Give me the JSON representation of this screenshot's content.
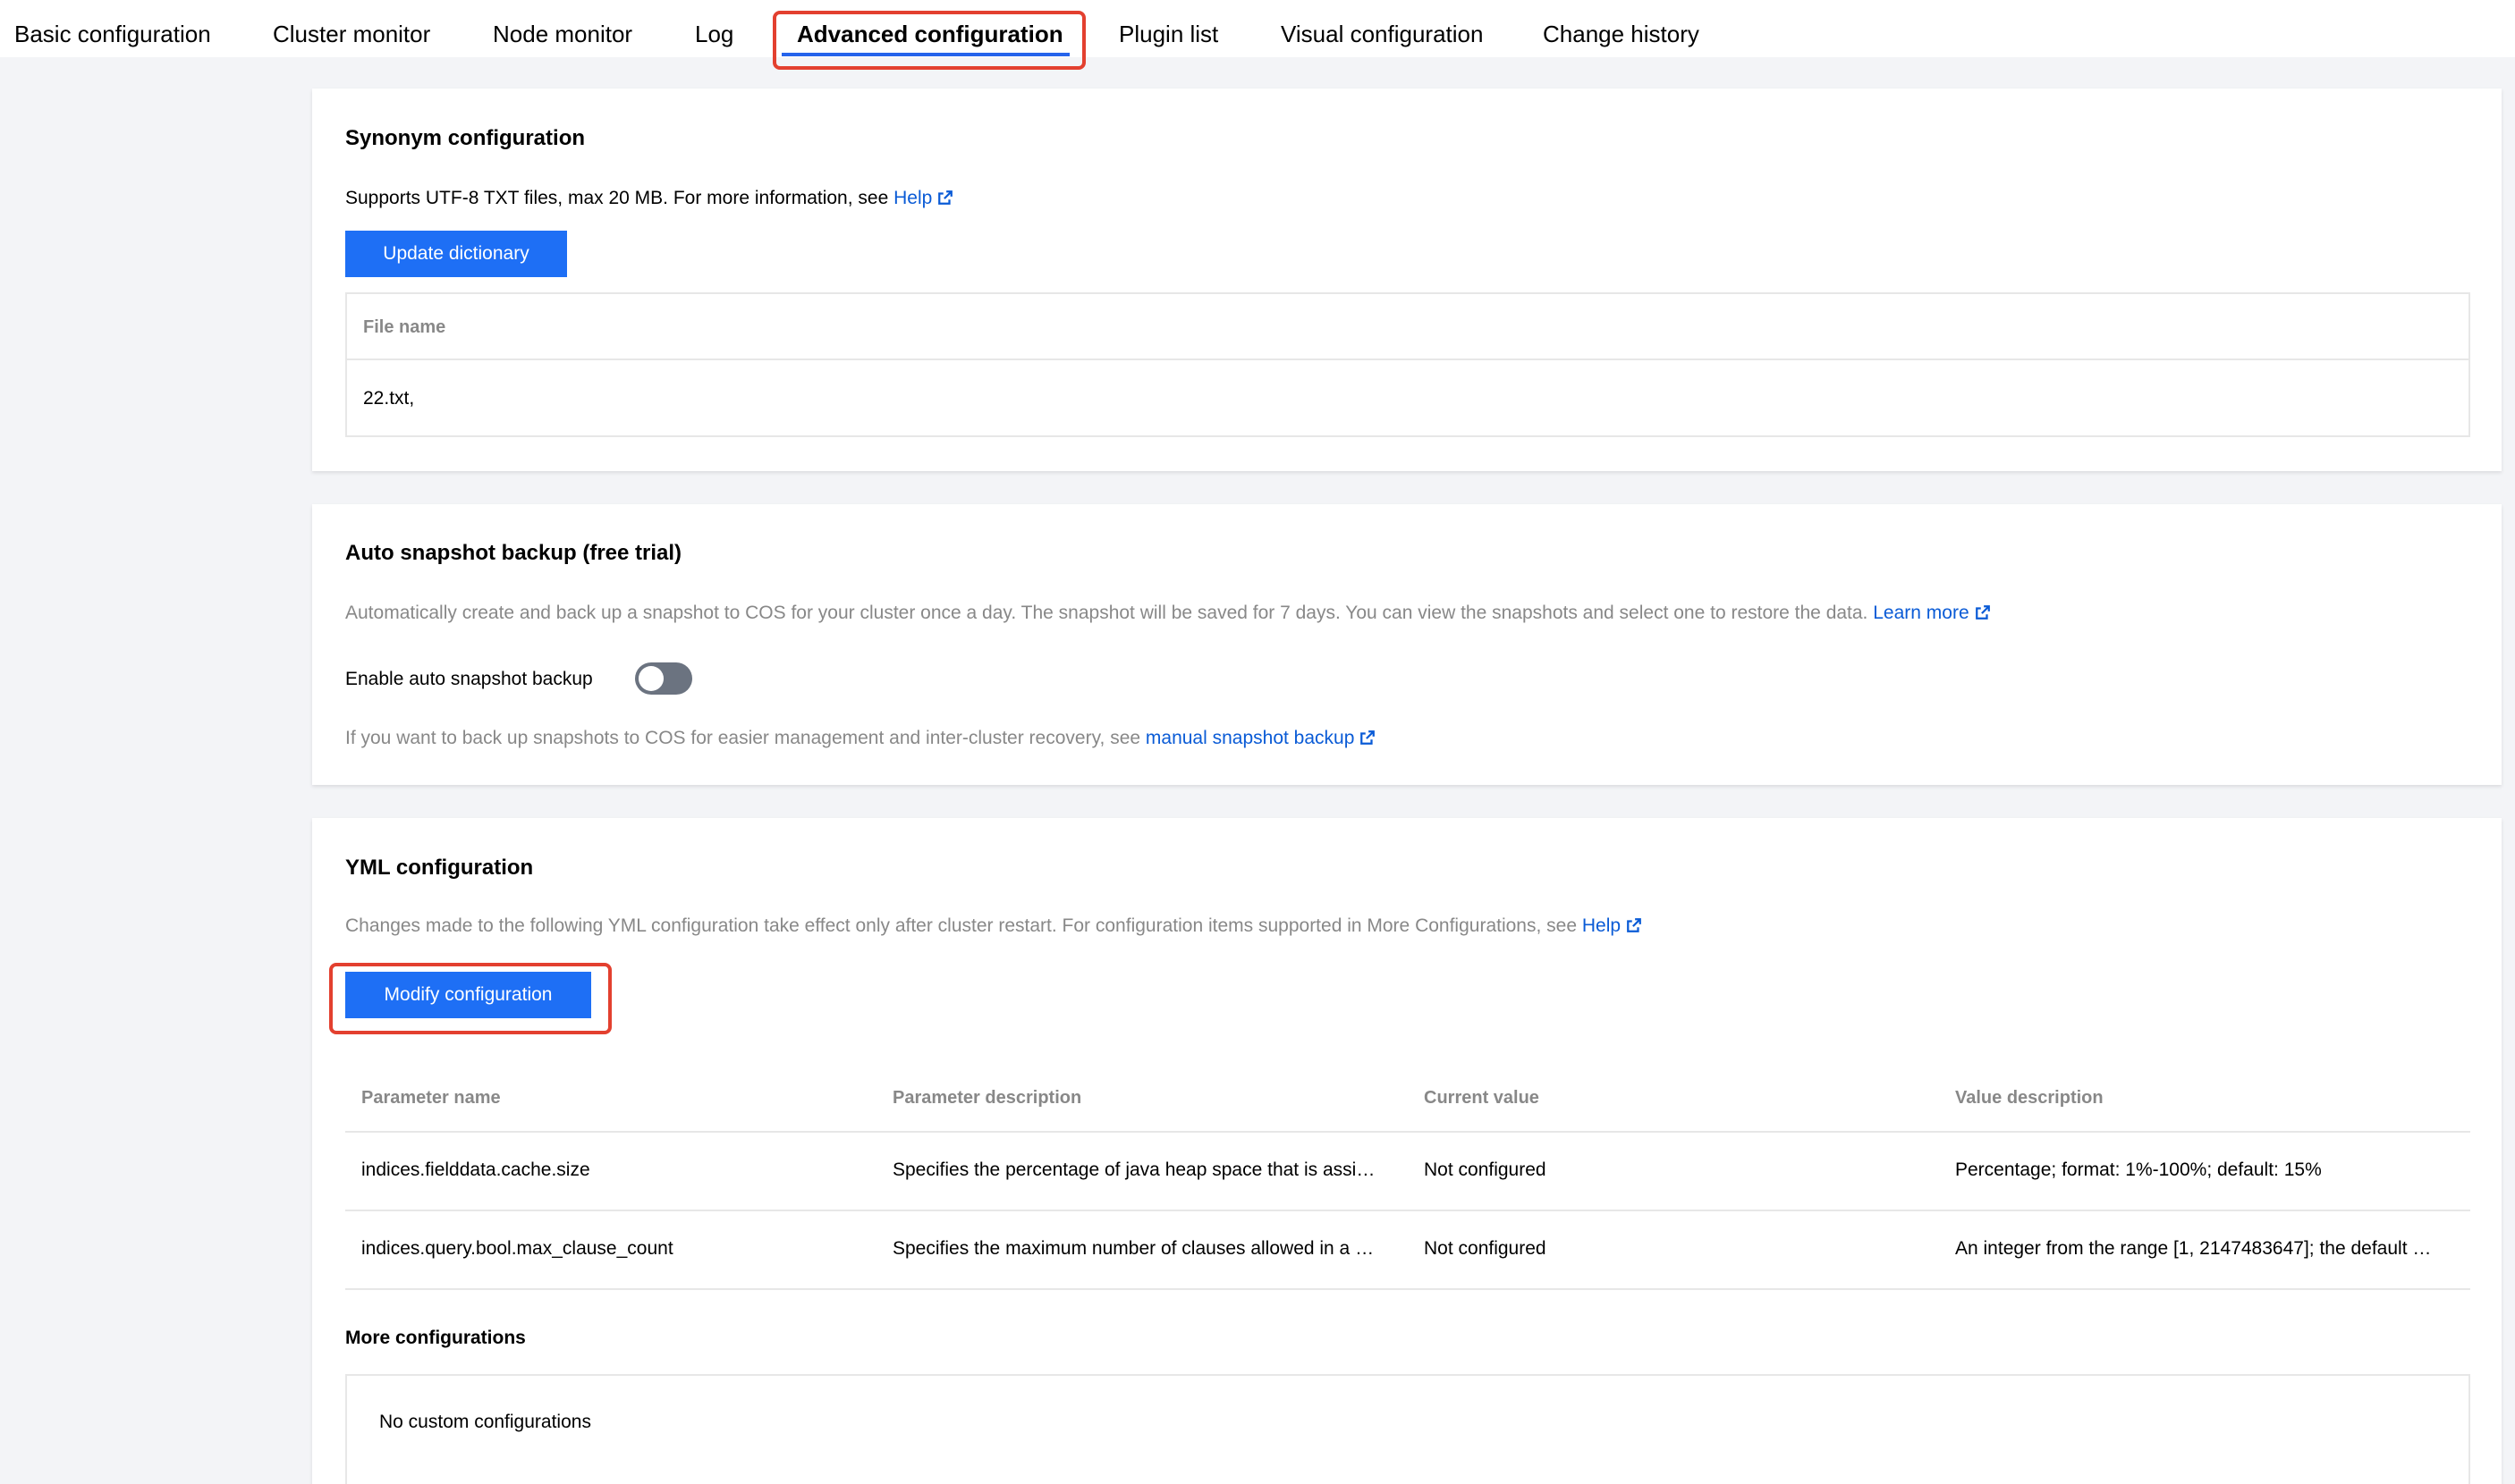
{
  "tabs": [
    {
      "label": "Basic configuration"
    },
    {
      "label": "Cluster monitor"
    },
    {
      "label": "Node monitor"
    },
    {
      "label": "Log"
    },
    {
      "label": "Advanced configuration",
      "active": true
    },
    {
      "label": "Plugin list"
    },
    {
      "label": "Visual configuration"
    },
    {
      "label": "Change history"
    }
  ],
  "synonym": {
    "title": "Synonym configuration",
    "desc": "Supports UTF-8 TXT files, max 20 MB. For more information, see",
    "help_link": "Help",
    "button": "Update dictionary",
    "table_header": "File name",
    "file": "22.txt,"
  },
  "snapshot": {
    "title": "Auto snapshot backup (free trial)",
    "desc": "Automatically create and back up a snapshot to COS for your cluster once a day. The snapshot will be saved for 7 days. You can view the snapshots and select one to restore the data.",
    "learn_more": "Learn more",
    "toggle_label": "Enable auto snapshot backup",
    "toggle_on": false,
    "note": "If you want to back up snapshots to COS for easier management and inter-cluster recovery, see",
    "manual_link": "manual snapshot backup"
  },
  "yml": {
    "title": "YML configuration",
    "desc": "Changes made to the following YML configuration take effect only after cluster restart. For configuration items supported in More Configurations, see",
    "help_link": "Help",
    "button": "Modify configuration",
    "columns": [
      "Parameter name",
      "Parameter description",
      "Current value",
      "Value description"
    ],
    "rows": [
      [
        "indices.fielddata.cache.size",
        "Specifies the percentage of java heap space that is assi…",
        "Not configured",
        "Percentage; format: 1%-100%; default: 15%"
      ],
      [
        "indices.query.bool.max_clause_count",
        "Specifies the maximum number of clauses allowed in a …",
        "Not configured",
        "An integer from the range [1, 2147483647]; the default …"
      ]
    ],
    "more_title": "More configurations",
    "more_empty": "No custom configurations"
  },
  "colors": {
    "accent": "#1e6ff5",
    "link": "#0a5bd6",
    "highlight": "#e3402f",
    "background": "#f3f4f7"
  }
}
